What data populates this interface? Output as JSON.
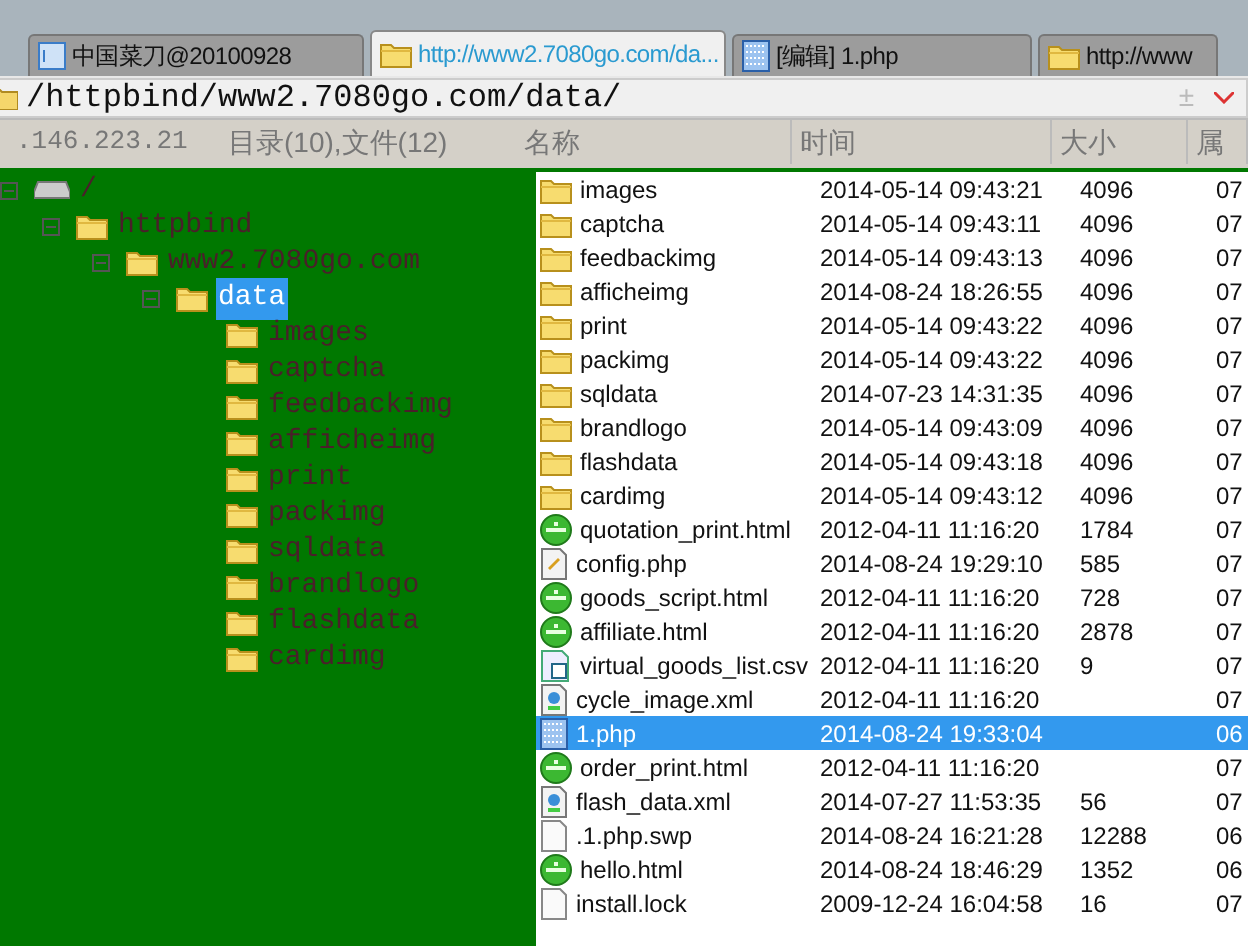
{
  "tabs": [
    {
      "label": "中国菜刀@20100928",
      "kind": "home",
      "selected": false
    },
    {
      "label": "http://www2.7080go.com/da...",
      "kind": "folder",
      "selected": true
    },
    {
      "label": "[编辑] 1.php",
      "kind": "edit",
      "selected": false
    },
    {
      "label": "http://www",
      "kind": "folder",
      "selected": false
    }
  ],
  "address": {
    "value": "/httpbind/www2.7080go.com/data/",
    "toggle": "±"
  },
  "info": {
    "host": ".146.223.21",
    "summary": "目录(10),文件(12)"
  },
  "tree": [
    {
      "label": "/",
      "kind": "drive",
      "expanded": true,
      "selected": false,
      "children": [
        {
          "label": "httpbind",
          "kind": "folder",
          "expanded": true,
          "selected": false,
          "children": [
            {
              "label": "www2.7080go.com",
              "kind": "folder",
              "expanded": true,
              "selected": false,
              "children": [
                {
                  "label": "data",
                  "kind": "folder",
                  "expanded": true,
                  "selected": true,
                  "children": [
                    {
                      "label": "images",
                      "kind": "folder",
                      "selected": false
                    },
                    {
                      "label": "captcha",
                      "kind": "folder",
                      "selected": false
                    },
                    {
                      "label": "feedbackimg",
                      "kind": "folder",
                      "selected": false
                    },
                    {
                      "label": "afficheimg",
                      "kind": "folder",
                      "selected": false
                    },
                    {
                      "label": "print",
                      "kind": "folder",
                      "selected": false
                    },
                    {
                      "label": "packimg",
                      "kind": "folder",
                      "selected": false
                    },
                    {
                      "label": "sqldata",
                      "kind": "folder",
                      "selected": false
                    },
                    {
                      "label": "brandlogo",
                      "kind": "folder",
                      "selected": false
                    },
                    {
                      "label": "flashdata",
                      "kind": "folder",
                      "selected": false
                    },
                    {
                      "label": "cardimg",
                      "kind": "folder",
                      "selected": false
                    }
                  ]
                }
              ]
            }
          ]
        }
      ]
    }
  ],
  "table": {
    "columns": [
      "名称",
      "时间",
      "大小",
      "属"
    ],
    "rows": [
      {
        "kind": "folder",
        "name": "images",
        "time": "2014-05-14 09:43:21",
        "size": "4096",
        "attr": "07",
        "selected": false
      },
      {
        "kind": "folder",
        "name": "captcha",
        "time": "2014-05-14 09:43:11",
        "size": "4096",
        "attr": "07",
        "selected": false
      },
      {
        "kind": "folder",
        "name": "feedbackimg",
        "time": "2014-05-14 09:43:13",
        "size": "4096",
        "attr": "07",
        "selected": false
      },
      {
        "kind": "folder",
        "name": "afficheimg",
        "time": "2014-08-24 18:26:55",
        "size": "4096",
        "attr": "07",
        "selected": false
      },
      {
        "kind": "folder",
        "name": "print",
        "time": "2014-05-14 09:43:22",
        "size": "4096",
        "attr": "07",
        "selected": false
      },
      {
        "kind": "folder",
        "name": "packimg",
        "time": "2014-05-14 09:43:22",
        "size": "4096",
        "attr": "07",
        "selected": false
      },
      {
        "kind": "folder",
        "name": "sqldata",
        "time": "2014-07-23 14:31:35",
        "size": "4096",
        "attr": "07",
        "selected": false
      },
      {
        "kind": "folder",
        "name": "brandlogo",
        "time": "2014-05-14 09:43:09",
        "size": "4096",
        "attr": "07",
        "selected": false
      },
      {
        "kind": "folder",
        "name": "flashdata",
        "time": "2014-05-14 09:43:18",
        "size": "4096",
        "attr": "07",
        "selected": false
      },
      {
        "kind": "folder",
        "name": "cardimg",
        "time": "2014-05-14 09:43:12",
        "size": "4096",
        "attr": "07",
        "selected": false
      },
      {
        "kind": "html",
        "name": "quotation_print.html",
        "time": "2012-04-11 11:16:20",
        "size": "1784",
        "attr": "07",
        "selected": false
      },
      {
        "kind": "php",
        "name": "config.php",
        "time": "2014-08-24 19:29:10",
        "size": "585",
        "attr": "07",
        "selected": false
      },
      {
        "kind": "html",
        "name": "goods_script.html",
        "time": "2012-04-11 11:16:20",
        "size": "728",
        "attr": "07",
        "selected": false
      },
      {
        "kind": "html",
        "name": "affiliate.html",
        "time": "2012-04-11 11:16:20",
        "size": "2878",
        "attr": "07",
        "selected": false
      },
      {
        "kind": "csv",
        "name": "virtual_goods_list.csv",
        "time": "2012-04-11 11:16:20",
        "size": "9",
        "attr": "07",
        "selected": false
      },
      {
        "kind": "xml",
        "name": "cycle_image.xml",
        "time": "2012-04-11 11:16:20",
        "attr": "07",
        "selected": false
      },
      {
        "kind": "edit",
        "name": "1.php",
        "time": "2014-08-24 19:33:04",
        "attr": "06",
        "selected": true
      },
      {
        "kind": "html",
        "name": "order_print.html",
        "time": "2012-04-11 11:16:20",
        "attr": "07",
        "selected": false
      },
      {
        "kind": "xml",
        "name": "flash_data.xml",
        "time": "2014-07-27 11:53:35",
        "size": "56",
        "attr": "07",
        "selected": false
      },
      {
        "kind": "file",
        "name": ".1.php.swp",
        "time": "2014-08-24 16:21:28",
        "size": "12288",
        "attr": "06",
        "selected": false
      },
      {
        "kind": "html",
        "name": "hello.html",
        "time": "2014-08-24 18:46:29",
        "size": "1352",
        "attr": "06",
        "selected": false
      },
      {
        "kind": "file",
        "name": "install.lock",
        "time": "2009-12-24 16:04:58",
        "size": "16",
        "attr": "07",
        "selected": false
      }
    ]
  }
}
